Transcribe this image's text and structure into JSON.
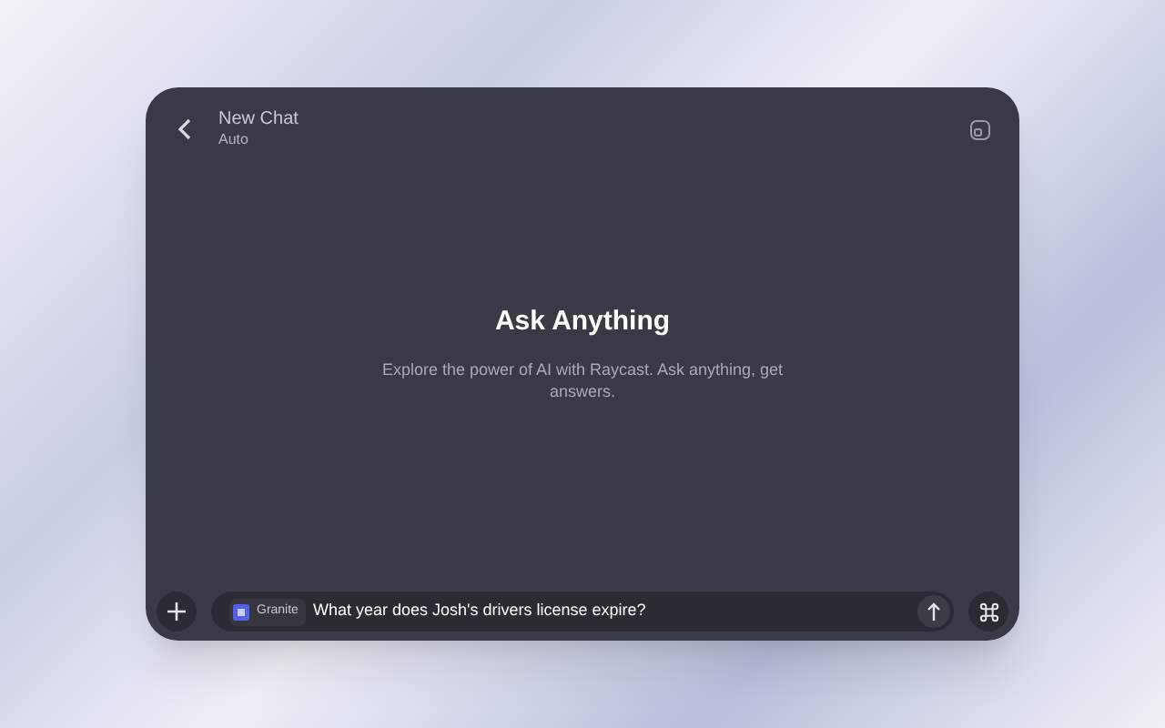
{
  "window": {
    "title": "New Chat",
    "subtitle": "Auto"
  },
  "hero": {
    "title": "Ask Anything",
    "text": "Explore the power of AI with Raycast. Ask anything, get answers."
  },
  "composer": {
    "model": "Granite",
    "value": "What year does Josh's drivers license expire?"
  }
}
